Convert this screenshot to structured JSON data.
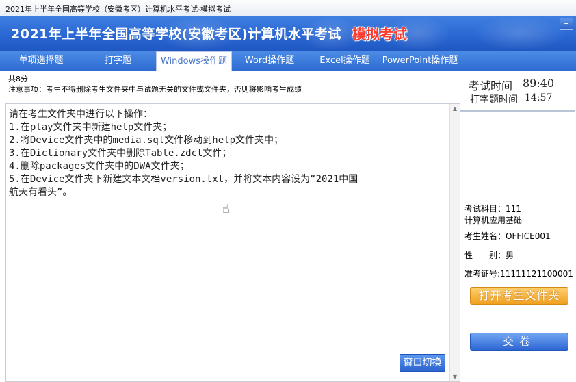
{
  "window": {
    "title": "2021年上半年全国高等学校（安徽考区）计算机水平考试-模拟考试"
  },
  "header": {
    "title": "2021年上半年全国高等学校(安徽考区)计算机水平考试",
    "mock_label": "模拟考试",
    "minimize_label": "–"
  },
  "tabs": [
    {
      "label": "单项选择题",
      "active": false
    },
    {
      "label": "打字题",
      "active": false
    },
    {
      "label": "Windows操作题",
      "active": true
    },
    {
      "label": "Word操作题",
      "active": false
    },
    {
      "label": "Excel操作题",
      "active": false
    },
    {
      "label": "PowerPoint操作题",
      "active": false
    }
  ],
  "question": {
    "score": "共8分",
    "notice": "注意事项：考生不得删除考生文件夹中与试题无关的文件或文件夹，否则将影响考生成绩",
    "lines": [
      "请在考生文件夹中进行以下操作：",
      "1.在play文件夹中新建help文件夹；",
      "2.将Device文件夹中的media.sql文件移动到help文件夹中；",
      "3.在Dictionary文件夹中删除Table.zdct文件；",
      "4.删除packages文件夹中的DWA文件夹；",
      "5.在Device文件夹下新建文本文档version.txt，并将文本内容设为“2021中国",
      "航天有看头”。"
    ],
    "switch_button": "窗口切换"
  },
  "timers": {
    "exam_time_label": "考试时间",
    "exam_time_value": "89:40",
    "typing_time_label": "打字题时间",
    "typing_time_value": "14:57"
  },
  "candidate": {
    "subject_line1": "考试科目：111",
    "subject_line2": "计算机应用基础",
    "name": "考生姓名：OFFICE001",
    "gender": "性　　别：男",
    "ticket": "准考证号:11111121100001"
  },
  "actions": {
    "open_folder": "打开考生文件夹",
    "submit": "交卷"
  }
}
